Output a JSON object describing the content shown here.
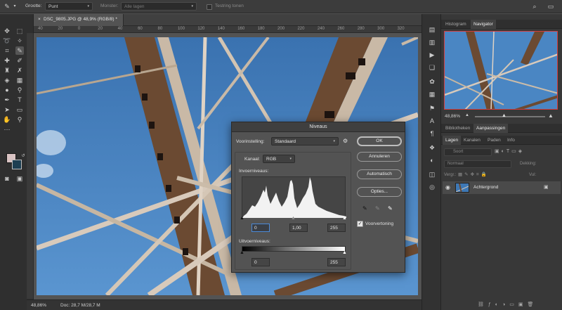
{
  "options_bar": {
    "size_label": "Grootte:",
    "size_value": "Punt",
    "sample_label": "Monster:",
    "sample_value": "Alle lagen",
    "ring_label": "Testring tonen"
  },
  "document": {
    "tab_title": "DSC_9805.JPG @ 48,9% (RGB/8) *",
    "ruler_ticks": [
      "40",
      "20",
      "0",
      "20",
      "40",
      "60",
      "80",
      "100",
      "120",
      "140",
      "160",
      "180",
      "200",
      "220",
      "240",
      "260",
      "280",
      "300",
      "320"
    ]
  },
  "status_bar": {
    "zoom": "48,86%",
    "doc_info": "Doc: 28,7 M/28,7 M"
  },
  "panels": {
    "top_tabs": [
      "Histogram",
      "Navigator"
    ],
    "navigator_zoom": "48,86%",
    "mid_tabs": [
      "Bibliotheken",
      "Aanpassingen"
    ],
    "layer_tabs": [
      "Lagen",
      "Kanalen",
      "Paden",
      "Info"
    ],
    "filter_placeholder": "Soort",
    "blend_mode": "Normaal",
    "opacity_label": "Dekking:",
    "lock_label": "Vergr.:",
    "fill_label": "Vul:",
    "layer_name": "Achtergrond"
  },
  "levels_dialog": {
    "title": "Niveaus",
    "preset_label": "Voorinstelling:",
    "preset_value": "Standaard",
    "channel_label": "Kanaal:",
    "channel_value": "RGB",
    "input_label": "Invoerniveaus:",
    "input_black": "0",
    "input_gamma": "1,00",
    "input_white": "255",
    "output_label": "Uitvoerniveaus:",
    "output_black": "0",
    "output_white": "255",
    "buttons": {
      "ok": "OK",
      "cancel": "Annuleren",
      "auto": "Automatisch",
      "options": "Opties..."
    },
    "preview_label": "Voorvertoning",
    "preview_checked": true
  },
  "colors": {
    "accent": "#4b8ad8",
    "navigator_frame": "#d43d3d",
    "foreground_swatch": "#d9c3c3",
    "background_swatch": "#1e3f52"
  }
}
